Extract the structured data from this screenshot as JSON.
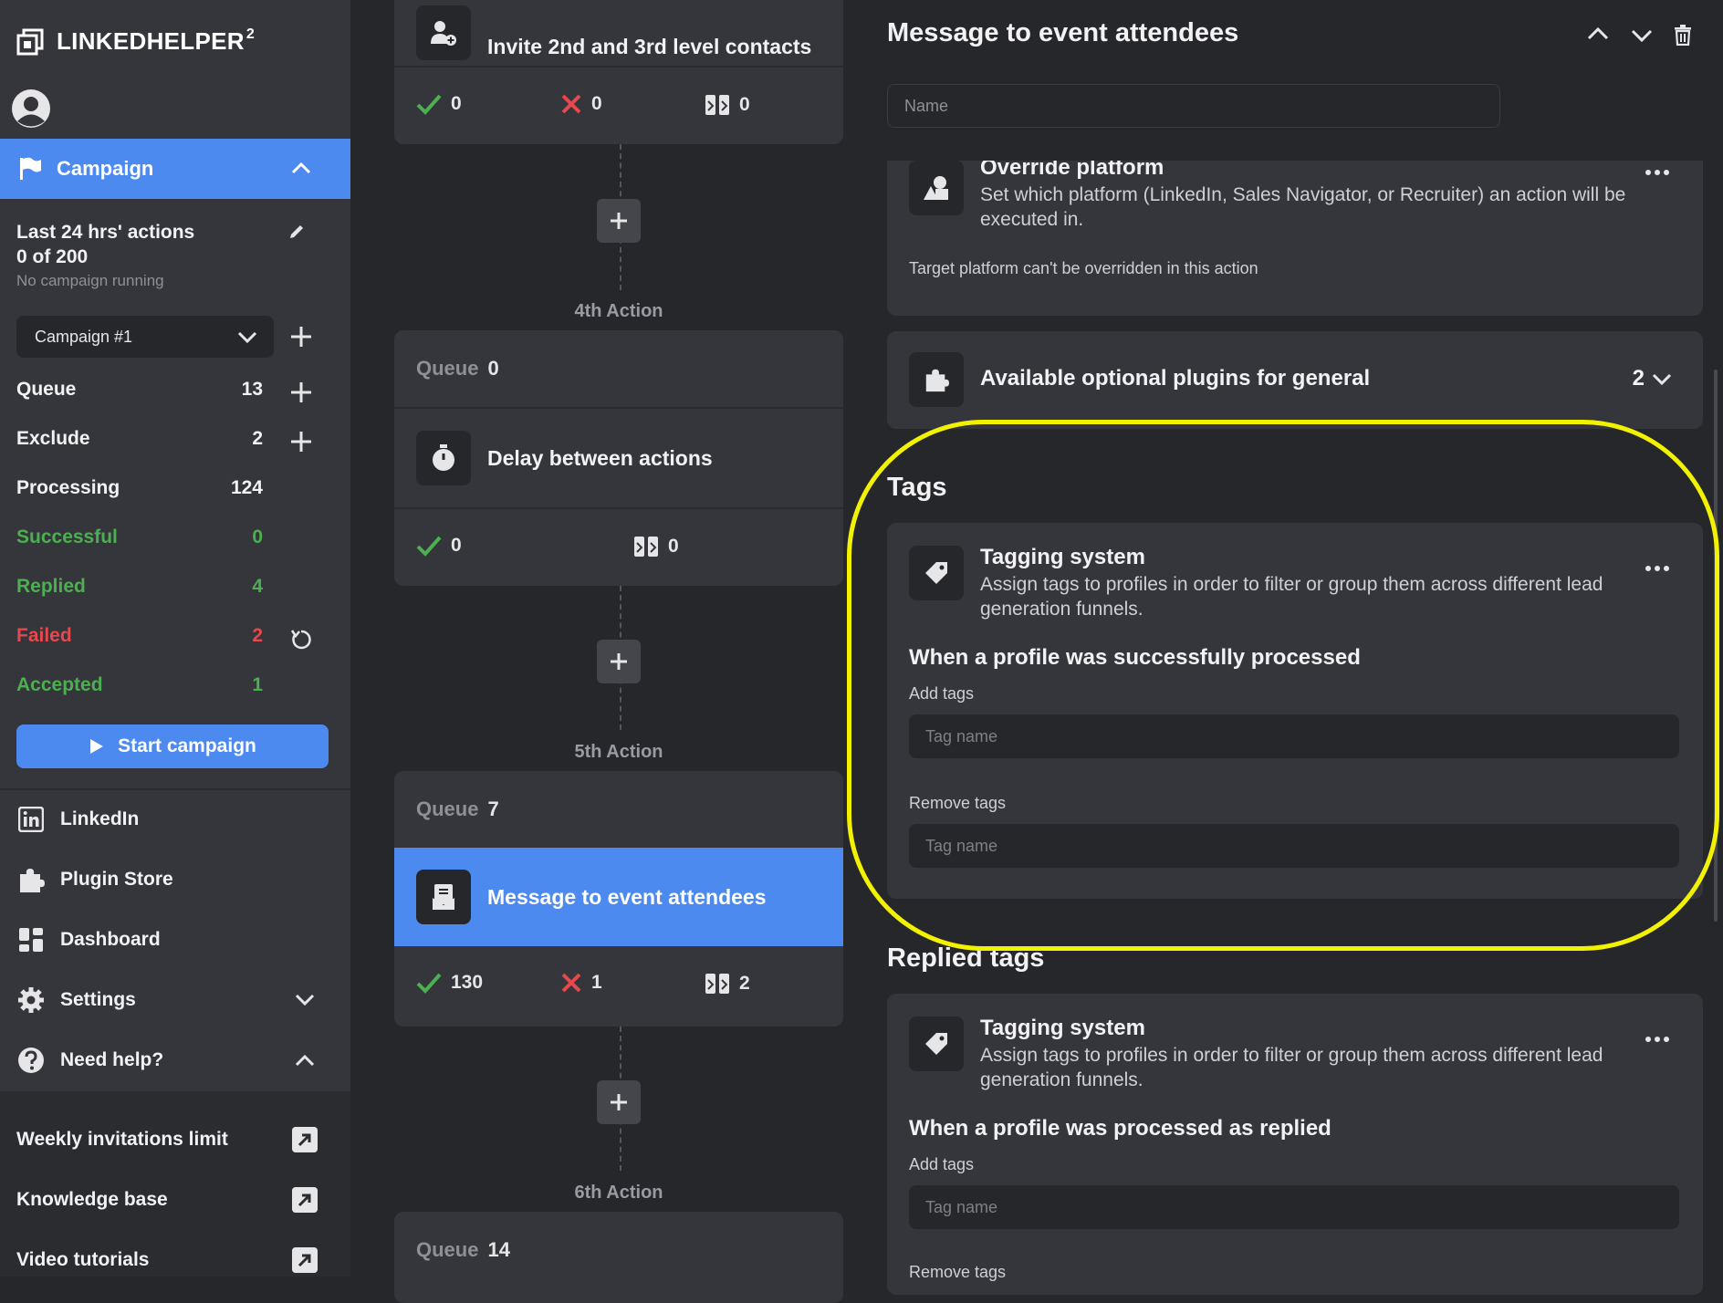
{
  "app": {
    "name": "LINKEDHELPER",
    "superscript": "2"
  },
  "sidebar": {
    "campaign_label": "Campaign",
    "actions_title": "Last 24 hrs' actions",
    "actions_count": "0 of 200",
    "actions_status": "No campaign running",
    "campaign_select": "Campaign #1",
    "stats": [
      {
        "label": "Queue",
        "value": "13"
      },
      {
        "label": "Exclude",
        "value": "2"
      },
      {
        "label": "Processing",
        "value": "124"
      },
      {
        "label": "Successful",
        "value": "0"
      },
      {
        "label": "Replied",
        "value": "4"
      },
      {
        "label": "Failed",
        "value": "2"
      },
      {
        "label": "Accepted",
        "value": "1"
      }
    ],
    "start_button": "Start campaign",
    "nav": [
      {
        "label": "LinkedIn",
        "icon": "linkedin-icon"
      },
      {
        "label": "Plugin Store",
        "icon": "puzzle-icon"
      },
      {
        "label": "Dashboard",
        "icon": "dashboard-icon"
      },
      {
        "label": "Settings",
        "icon": "gear-icon"
      },
      {
        "label": "Need help?",
        "icon": "help-icon"
      }
    ],
    "help_links": [
      {
        "label": "Weekly invitations limit"
      },
      {
        "label": "Knowledge base"
      },
      {
        "label": "Video tutorials"
      }
    ]
  },
  "flow": {
    "card0": {
      "title": "Invite 2nd and 3rd level contacts",
      "success": "0",
      "failed": "0",
      "skipped": "0"
    },
    "action4": {
      "label": "4th Action",
      "queue_label": "Queue",
      "queue": "0",
      "title": "Delay between actions",
      "success": "0",
      "skipped": "0"
    },
    "action5": {
      "label": "5th Action",
      "queue_label": "Queue",
      "queue": "7",
      "title": "Message to event attendees",
      "success": "130",
      "failed": "1",
      "skipped": "2"
    },
    "action6": {
      "label": "6th Action",
      "queue_label": "Queue",
      "queue": "14"
    }
  },
  "detail": {
    "title": "Message to event attendees",
    "name_placeholder": "Name",
    "override": {
      "title": "Override platform",
      "desc": "Set which platform (LinkedIn, Sales Navigator, or Recruiter) an action will be executed in.",
      "note": "Target platform can't be overridden in this action"
    },
    "plugins": {
      "title": "Available optional plugins for general",
      "count": "2"
    },
    "tags": {
      "section": "Tags",
      "title": "Tagging system",
      "desc": "Assign tags to profiles in order to filter or group them across different lead generation funnels.",
      "when": "When a profile was successfully processed",
      "add_label": "Add tags",
      "remove_label": "Remove tags",
      "placeholder": "Tag name"
    },
    "replied": {
      "section": "Replied tags",
      "title": "Tagging system",
      "desc": "Assign tags to profiles in order to filter or group them across different lead generation funnels.",
      "when": "When a profile was processed as replied",
      "add_label": "Add tags",
      "remove_label": "Remove tags",
      "placeholder": "Tag name"
    }
  },
  "colors": {
    "accent": "#4c8af0",
    "success": "#4caf50",
    "failed": "#e5484d",
    "highlight": "#f2f200"
  }
}
